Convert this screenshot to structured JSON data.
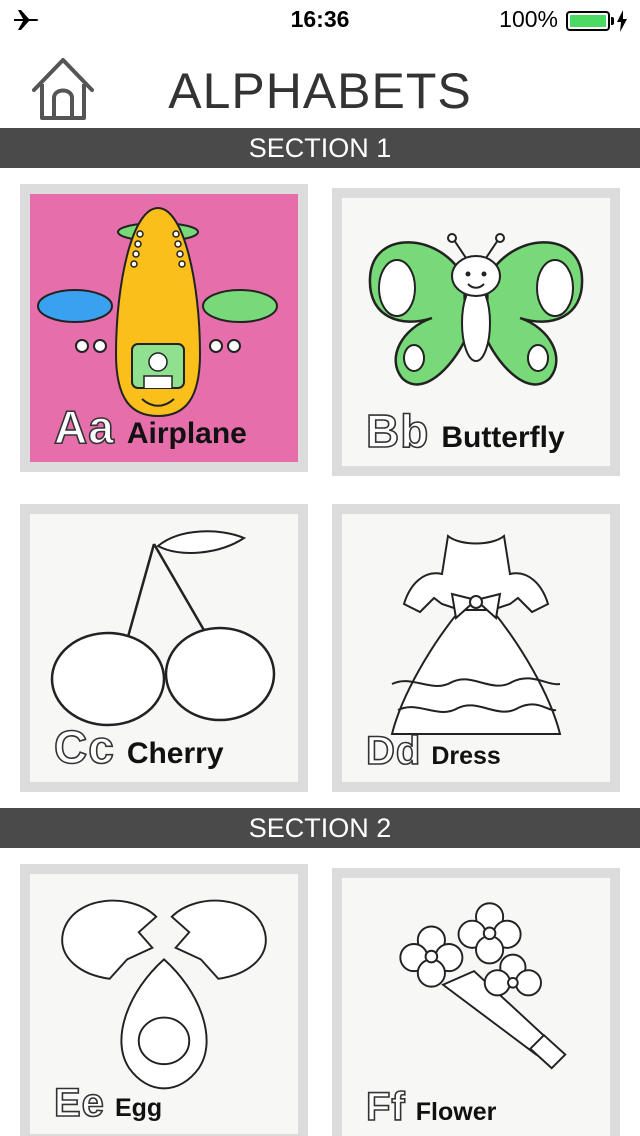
{
  "status_bar": {
    "time": "16:36",
    "battery_percent": "100%",
    "battery_level": 1.0,
    "battery_color": "#4cd964",
    "icons": [
      "airplane-mode-icon",
      "battery-icon",
      "charging-bolt-icon"
    ]
  },
  "header": {
    "title": "ALPHABETS",
    "home_icon": "home-icon"
  },
  "sections": [
    {
      "title": "SECTION 1",
      "cards": [
        {
          "letters": "Aa",
          "word": "Airplane",
          "background": "#e66eaa"
        },
        {
          "letters": "Bb",
          "word": "Butterfly",
          "background": "#f7f7f5"
        },
        {
          "letters": "Cc",
          "word": "Cherry",
          "background": "#f7f7f5"
        },
        {
          "letters": "Dd",
          "word": "Dress",
          "background": "#f7f7f5"
        }
      ]
    },
    {
      "title": "SECTION 2",
      "cards": [
        {
          "letters": "Ee",
          "word": "Egg",
          "background": "#f7f7f5"
        },
        {
          "letters": "Ff",
          "word": "Flower",
          "background": "#f7f7f5"
        }
      ]
    }
  ],
  "colors": {
    "section_bar": "#4a4a4a",
    "card_border": "#dcdcdc"
  }
}
